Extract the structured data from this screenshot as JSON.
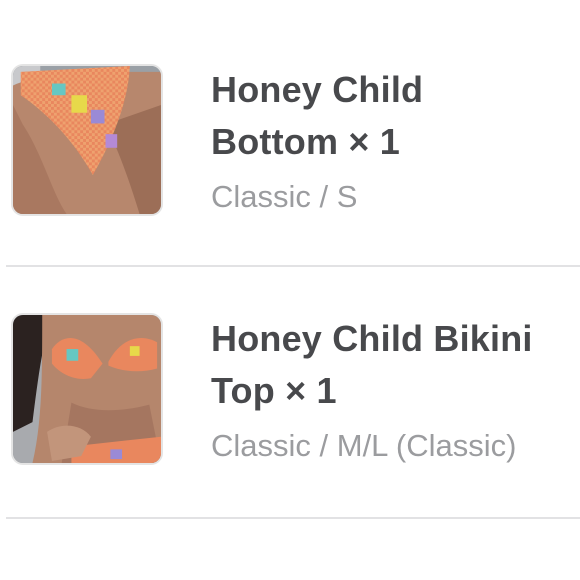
{
  "cart": {
    "items": [
      {
        "title_line1": "Honey Child",
        "title_line2": "Bottom × 1",
        "variant": "Classic / S",
        "thumbnail": "product-photo-bottom"
      },
      {
        "title_line1": "Honey Child Bikini",
        "title_line2": "Top × 1",
        "variant": "Classic / M/L (Classic)",
        "thumbnail": "product-photo-top"
      }
    ]
  },
  "colors": {
    "title": "#48494c",
    "variant": "#9b9c9f",
    "divider": "#e2e2e4"
  }
}
